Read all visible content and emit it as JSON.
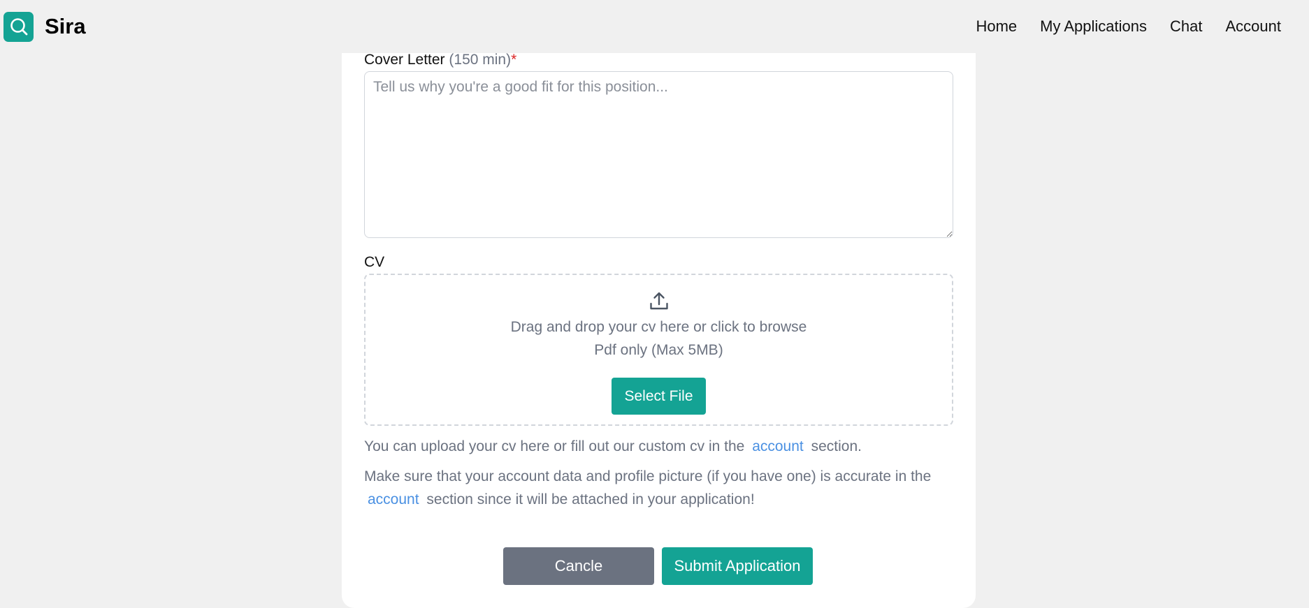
{
  "header": {
    "brand": "Sira",
    "logo_icon": "search-icon",
    "nav": [
      {
        "label": "Home"
      },
      {
        "label": "My Applications"
      },
      {
        "label": "Chat"
      },
      {
        "label": "Account"
      }
    ]
  },
  "form": {
    "cover_letter": {
      "label": "Cover Letter",
      "hint": "(150 min)",
      "required_mark": "*",
      "value": "",
      "placeholder": "Tell us why you're a good fit for this position..."
    },
    "cv": {
      "label": "CV",
      "upload_icon": "upload-icon",
      "drop_text": "Drag and drop your cv here or click to browse",
      "format_text": "Pdf only (Max 5MB)",
      "select_label": "Select File"
    },
    "note1": {
      "before": "You can upload your cv here or fill out our custom cv in the",
      "link": "account",
      "after": "section."
    },
    "note2": {
      "before": "Make sure that your account data and profile picture (if you have one) is accurate in the",
      "link": "account",
      "after": "section since it will be attached in your application!"
    },
    "actions": {
      "cancel_label": "Cancle",
      "submit_label": "Submit Application"
    }
  },
  "colors": {
    "accent": "#14a394",
    "cancel": "#6b7280",
    "link": "#4a90e2",
    "required": "#dc2626",
    "background": "#f0f0f0"
  }
}
